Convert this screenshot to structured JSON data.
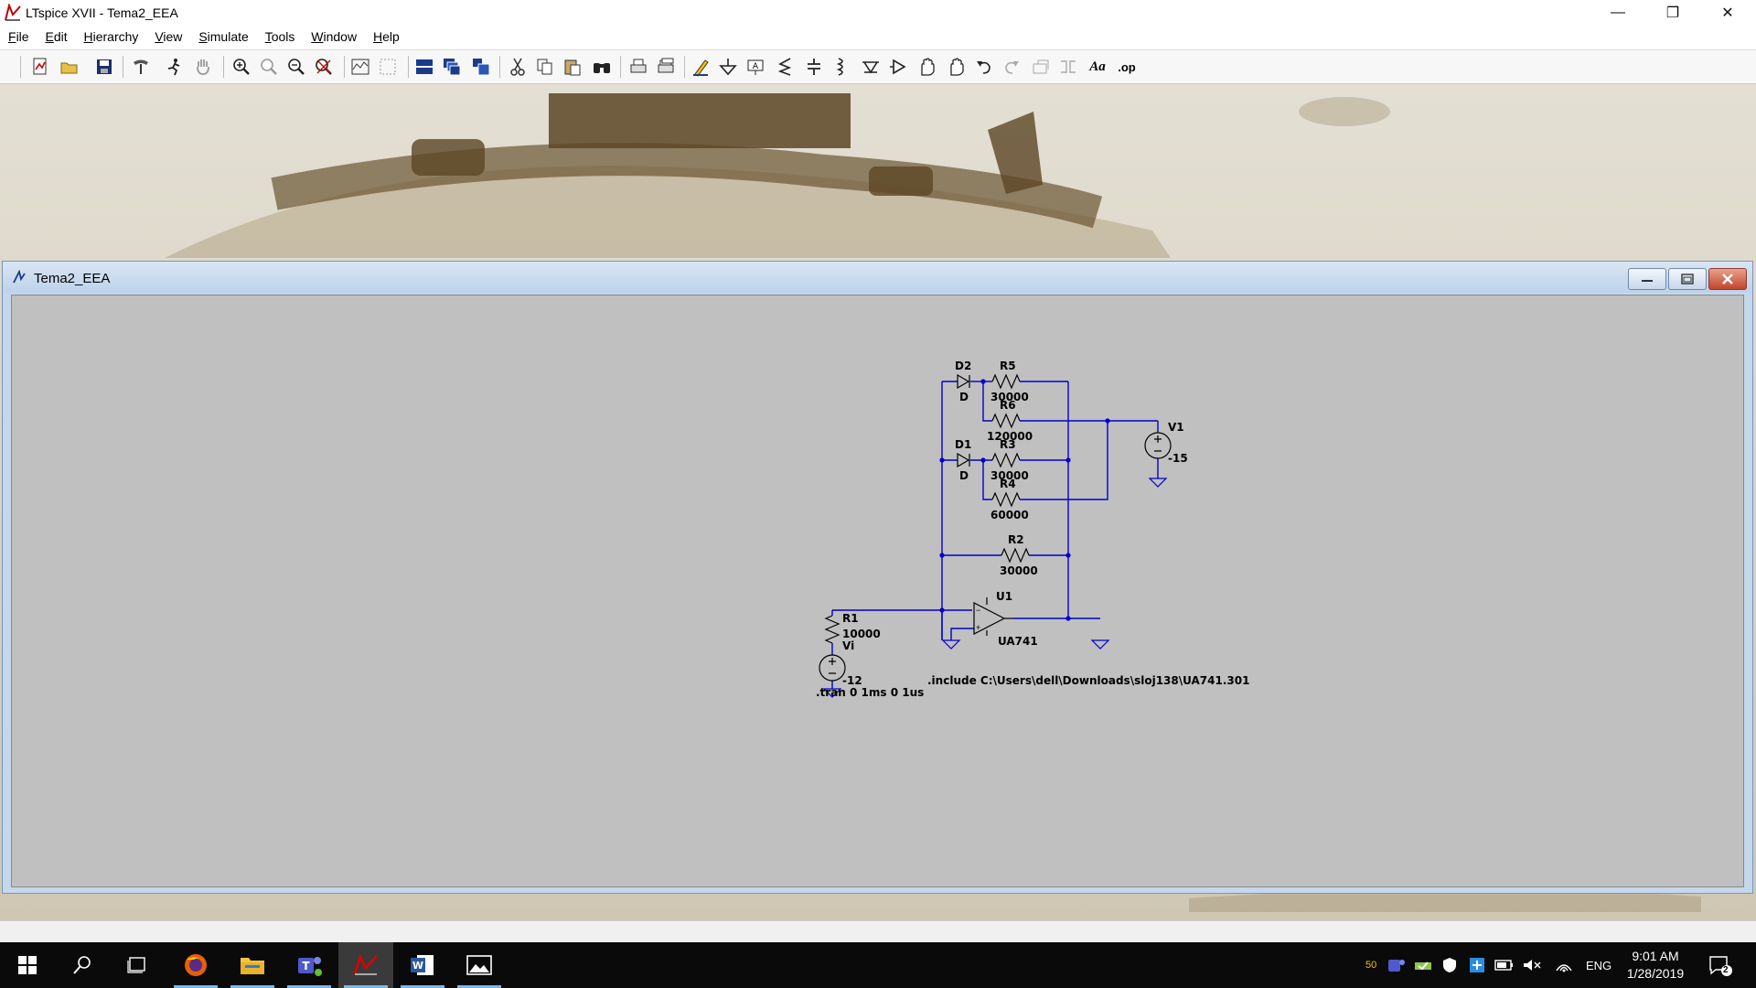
{
  "app": {
    "title": "LTspice XVII - Tema2_EEA"
  },
  "window_controls": {
    "minimize": "—",
    "restore": "❐",
    "close": "✕"
  },
  "menu": [
    {
      "label": "File",
      "underline": "F",
      "rest": "ile"
    },
    {
      "label": "Edit",
      "underline": "E",
      "rest": "dit"
    },
    {
      "label": "Hierarchy",
      "underline": "H",
      "rest": "ierarchy"
    },
    {
      "label": "View",
      "underline": "V",
      "rest": "iew"
    },
    {
      "label": "Simulate",
      "underline": "S",
      "rest": "imulate"
    },
    {
      "label": "Tools",
      "underline": "T",
      "rest": "ools"
    },
    {
      "label": "Window",
      "underline": "W",
      "rest": "indow"
    },
    {
      "label": "Help",
      "underline": "H",
      "rest": "elp"
    }
  ],
  "toolbar": {
    "icons": [
      "new-schematic-icon",
      "open-icon",
      "save-icon",
      "control-panel-icon",
      "run-icon",
      "halt-icon",
      "zoom-in-icon",
      "pan-icon",
      "zoom-out-icon",
      "zoom-fit-icon",
      "autorange-icon",
      "setup-icon",
      "tile-horizontal-icon",
      "cascade-icon",
      "tile-vertical-icon",
      "cut-icon",
      "copy-icon",
      "paste-icon",
      "find-icon",
      "print-icon",
      "print-preview-icon",
      "draw-wire-icon",
      "ground-icon",
      "label-net-icon",
      "resistor-icon",
      "capacitor-icon",
      "inductor-icon",
      "diode-icon",
      "component-icon",
      "move-icon",
      "drag-icon",
      "undo-icon",
      "redo-icon",
      "rotate-icon",
      "mirror-icon",
      "text-icon",
      "spice-directive-icon"
    ],
    "text_label": "Aa",
    "op_label": ".op"
  },
  "child_window": {
    "title": "Tema2_EEA"
  },
  "schematic": {
    "components": {
      "D2": {
        "name": "D2",
        "model": "D"
      },
      "D1": {
        "name": "D1",
        "model": "D"
      },
      "R5": {
        "name": "R5",
        "value": "30000"
      },
      "R6": {
        "name": "R6",
        "value": "120000"
      },
      "R3": {
        "name": "R3",
        "value": "30000"
      },
      "R4": {
        "name": "R4",
        "value": "60000"
      },
      "R2": {
        "name": "R2",
        "value": "30000"
      },
      "R1": {
        "name": "R1",
        "value": "10000"
      },
      "V1": {
        "name": "V1",
        "value": "-15"
      },
      "Vi": {
        "name": "Vi",
        "value": "-12"
      },
      "U1": {
        "name": "U1",
        "model": "UA741"
      }
    },
    "directives": {
      "tran": ".tran 0 1ms 0 1us",
      "include": ".include C:\\Users\\dell\\Downloads\\sloj138\\UA741.301"
    },
    "wire_color": "#0000cc"
  },
  "taskbar": {
    "apps": [
      "start-icon",
      "search-icon",
      "task-view-icon",
      "firefox-icon",
      "file-explorer-icon",
      "teams-icon",
      "ltspice-icon",
      "word-icon",
      "photos-icon"
    ],
    "tray_number": "50",
    "language": "ENG",
    "time": "9:01 AM",
    "date": "1/28/2019",
    "notification_count": "2"
  }
}
